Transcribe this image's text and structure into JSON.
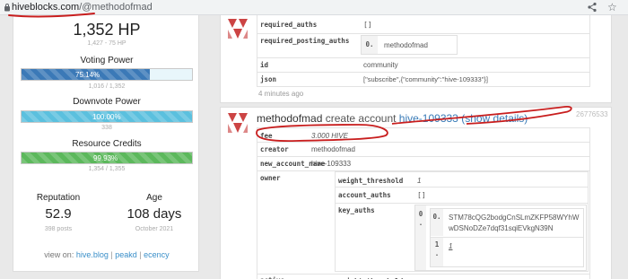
{
  "browser": {
    "url_host": "hiveblocks.com",
    "url_path": "/@methodofmad"
  },
  "profile": {
    "hp": "1,352 HP",
    "hp_detail": "1,427 - 75 HP",
    "voting_power": {
      "title": "Voting Power",
      "percent": 75.14,
      "label": "75.14%",
      "detail": "1,016 / 1,352",
      "color": "#3b79b7"
    },
    "downvote_power": {
      "title": "Downvote Power",
      "percent": 100.0,
      "label": "100.00%",
      "detail": "338",
      "color": "#5bc0de"
    },
    "resource_credits": {
      "title": "Resource Credits",
      "percent": 99.93,
      "label": "99.93%",
      "detail": "1,354 / 1,355",
      "color": "#5cb85c"
    },
    "reputation": {
      "title": "Reputation",
      "value": "52.9",
      "detail": "398 posts"
    },
    "age": {
      "title": "Age",
      "value": "108 days",
      "detail": "October 2021"
    },
    "view_on": {
      "label": "view on:",
      "links": [
        "hive.blog",
        "peakd",
        "ecency"
      ],
      "sep": "|"
    }
  },
  "op1": {
    "rows": [
      {
        "key": "required_auths",
        "value": "[]"
      },
      {
        "key": "required_posting_auths",
        "index": "0.",
        "value": "methodofmad"
      },
      {
        "key": "id",
        "value": "community"
      },
      {
        "key": "json",
        "value": "[\"subscribe\",{\"community\":\"hive-109333\"}]"
      }
    ],
    "time": "4 minutes ago"
  },
  "op2": {
    "user": "methodofmad",
    "action": "create account",
    "target": "hive-109333",
    "details_link": "(show details)",
    "number": "26776533",
    "rows": {
      "fee": {
        "key": "fee",
        "value": "3.000 HIVE"
      },
      "creator": {
        "key": "creator",
        "value": "methodofmad"
      },
      "new_account_name": {
        "key": "new_account_name",
        "value": "hive-109333"
      },
      "owner": {
        "key": "owner",
        "weight_threshold": {
          "key": "weight_threshold",
          "value": "1"
        },
        "account_auths": {
          "key": "account_auths",
          "value": "[]"
        },
        "key_auths": {
          "key": "key_auths",
          "idx0": "0",
          "idx0b": ".",
          "sub_idx0": "0.",
          "key_line1": "STM78cQG2bodgCnSLmZKFP58WYhW",
          "key_line2": "wDSNoDZe7dqf31sqiEVkgN39N",
          "sub_idx1": "1",
          "sub_idx1b": ".",
          "weight": "1"
        }
      },
      "active": {
        "key": "active",
        "sub_key": "weight_threshold"
      }
    }
  },
  "icons": {
    "avatar": "hive-logo-icon",
    "share": "share-icon",
    "star": "star-icon",
    "lock": "lock-icon"
  },
  "colors": {
    "link": "#3a7bb7",
    "annotation": "#c81e1e"
  }
}
